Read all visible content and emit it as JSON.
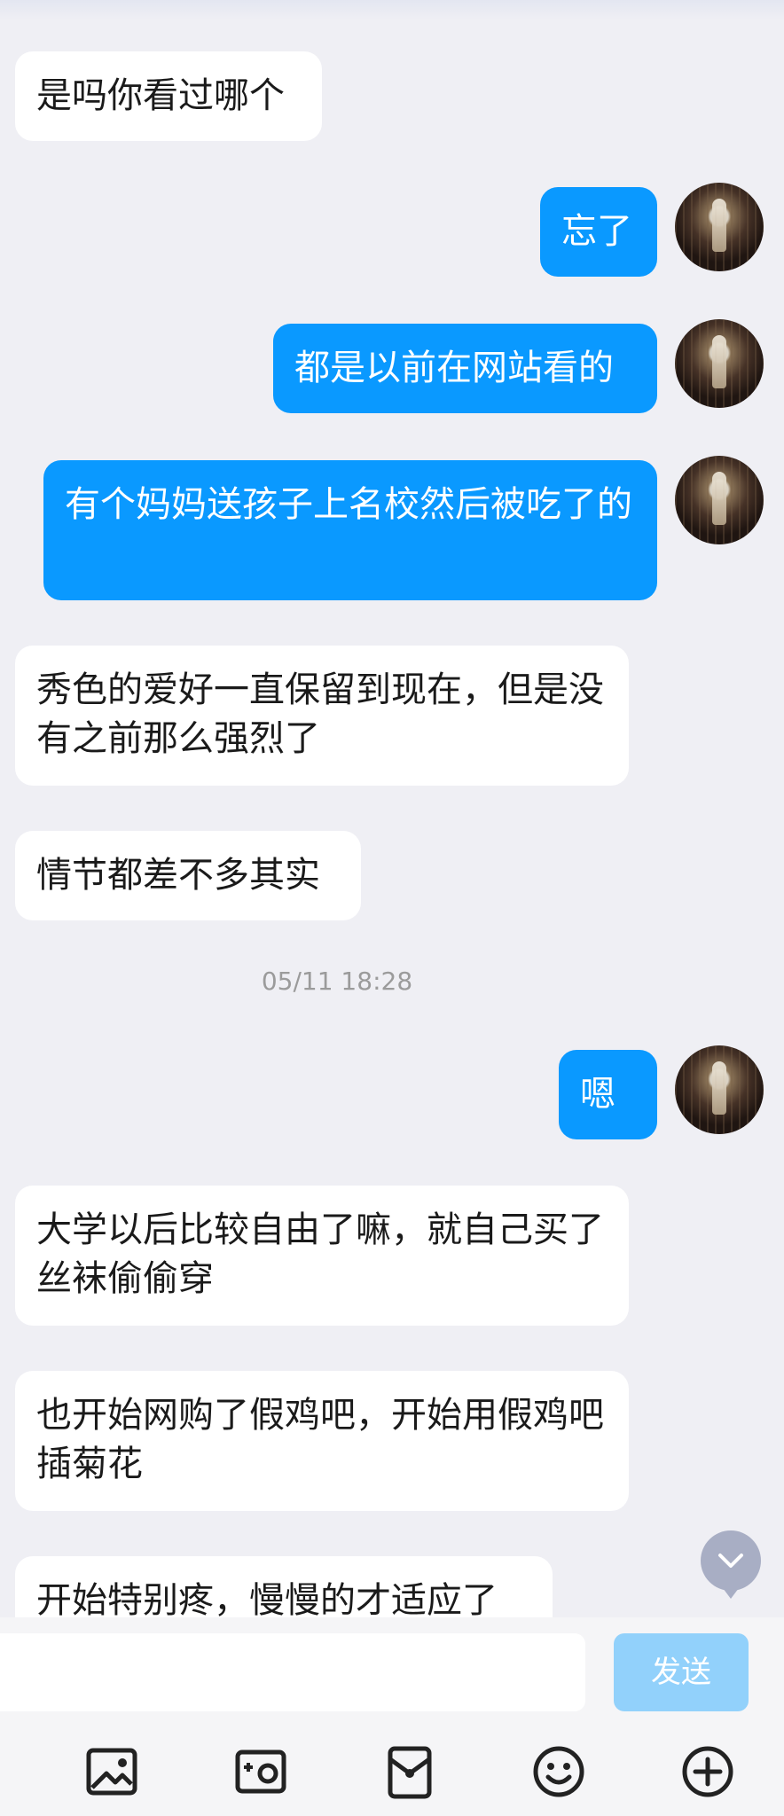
{
  "messages": [
    {
      "side": "in",
      "text": "是吗你看过哪个"
    },
    {
      "side": "out",
      "text": "忘了"
    },
    {
      "side": "out",
      "text": "都是以前在网站看的"
    },
    {
      "side": "out",
      "text": "有个妈妈送孩子上名校然后被吃了的"
    },
    {
      "side": "in",
      "text": "秀色的爱好一直保留到现在，但是没有之前那么强烈了"
    },
    {
      "side": "in",
      "text": "情节都差不多其实"
    },
    {
      "side": "out",
      "text": "嗯"
    },
    {
      "side": "in",
      "text": "大学以后比较自由了嘛，就自己买了丝袜偷偷穿"
    },
    {
      "side": "in",
      "text": "也开始网购了假鸡吧，开始用假鸡吧插菊花"
    },
    {
      "side": "in",
      "text": "开始特别疼，慢慢的才适应了"
    }
  ],
  "timestamp": "05/11 18:28",
  "composer": {
    "input_value": "",
    "send_label": "发送"
  },
  "toolbar": [
    "image-icon",
    "camera-icon",
    "red-packet-icon",
    "emoji-icon",
    "plus-icon"
  ],
  "colors": {
    "background": "#efeff4",
    "outgoing_bubble": "#0a99ff",
    "incoming_bubble": "#ffffff",
    "send_button_disabled": "#92d1fb"
  }
}
